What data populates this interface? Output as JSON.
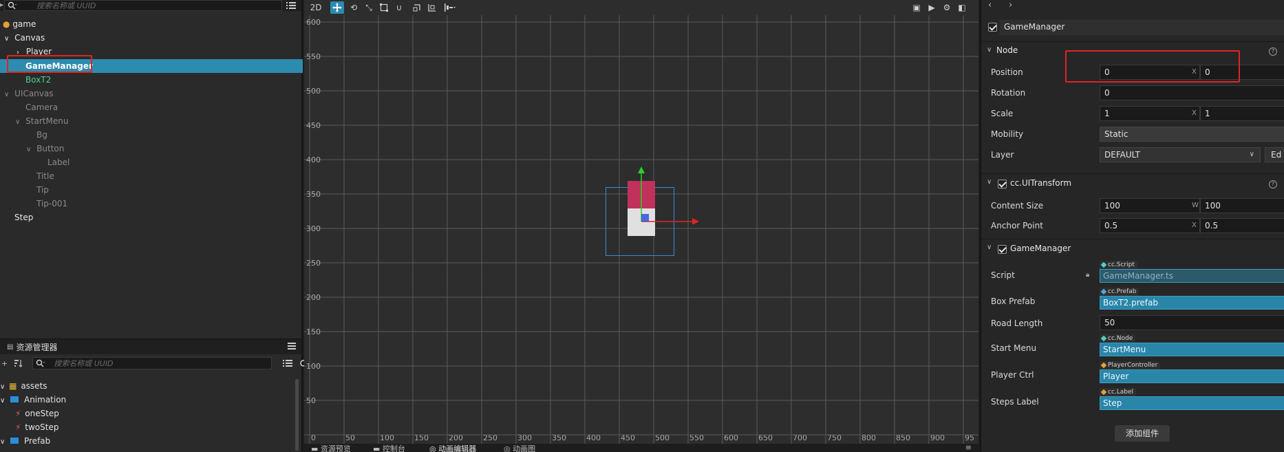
{
  "hierarchy": {
    "search_placeholder": "搜索名称或 UUID",
    "nodes": [
      {
        "label": "game"
      },
      {
        "label": "Canvas"
      },
      {
        "label": "Player"
      },
      {
        "label": "GameManager"
      },
      {
        "label": "BoxT2"
      },
      {
        "label": "UICanvas"
      },
      {
        "label": "Camera"
      },
      {
        "label": "StartMenu"
      },
      {
        "label": "Bg"
      },
      {
        "label": "Button"
      },
      {
        "label": "Label"
      },
      {
        "label": "Title"
      },
      {
        "label": "Tip"
      },
      {
        "label": "Tip-001"
      },
      {
        "label": "Step"
      }
    ]
  },
  "assets": {
    "title": "资源管理器",
    "search_placeholder": "搜索名称或 UUID",
    "items": [
      {
        "label": "assets"
      },
      {
        "label": "Animation"
      },
      {
        "label": "oneStep"
      },
      {
        "label": "twoStep"
      },
      {
        "label": "Prefab"
      }
    ]
  },
  "scene": {
    "mode_label": "2D",
    "y_ticks": [
      "600",
      "550",
      "500",
      "450",
      "400",
      "350",
      "300",
      "250",
      "200",
      "150",
      "100",
      "50"
    ],
    "x_ticks": [
      "0",
      "50",
      "100",
      "150",
      "200",
      "250",
      "300",
      "350",
      "400",
      "450",
      "500",
      "550",
      "600",
      "650",
      "700",
      "750",
      "800",
      "850",
      "900",
      "95"
    ],
    "bottom_tabs": [
      "资源预览",
      "控制台",
      "动画编辑器",
      "动画图"
    ]
  },
  "inspector": {
    "node_name": "GameManager",
    "node_section": {
      "title": "Node",
      "position_label": "Position",
      "position_x": "0",
      "position_y": "0",
      "rotation_label": "Rotation",
      "rotation": "0",
      "scale_label": "Scale",
      "scale_x": "1",
      "scale_y": "1",
      "mobility_label": "Mobility",
      "mobility": "Static",
      "layer_label": "Layer",
      "layer": "DEFAULT",
      "layer_edit": "Ed"
    },
    "uitransform": {
      "title": "cc.UITransform",
      "content_size_label": "Content Size",
      "width": "100",
      "height": "100",
      "anchor_label": "Anchor Point",
      "anchor_x": "0.5",
      "anchor_y": "0.5"
    },
    "gamemanager": {
      "title": "GameManager",
      "script_label": "Script",
      "script_type": "cc.Script",
      "script": "GameManager.ts",
      "box_prefab_label": "Box Prefab",
      "box_prefab_type": "cc.Prefab",
      "box_prefab": "BoxT2.prefab",
      "road_length_label": "Road Length",
      "road_length": "50",
      "start_menu_label": "Start Menu",
      "start_menu_type": "cc.Node",
      "start_menu": "StartMenu",
      "player_ctrl_label": "Player Ctrl",
      "player_ctrl_type": "PlayerController",
      "player_ctrl": "Player",
      "steps_label_label": "Steps Label",
      "steps_label_type": "cc.Label",
      "steps_label": "Step"
    },
    "add_component": "添加组件"
  },
  "colors": {
    "selection": "#2c8cb0",
    "highlight": "#e02424",
    "field_blue": "#2a86a8",
    "prefab_green": "#4fd18b"
  }
}
